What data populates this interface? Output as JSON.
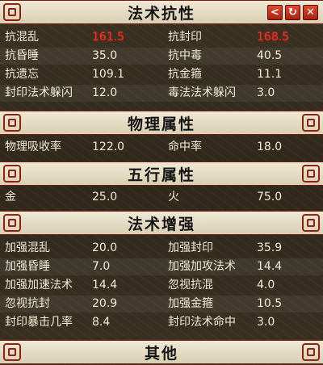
{
  "window": {
    "share_icon": "share-icon",
    "refresh_icon": "refresh-icon",
    "close_icon": "close-icon"
  },
  "sections": [
    {
      "title": "法术抗性",
      "rows": [
        [
          "抗混乱",
          "161.5",
          "抗封印",
          "168.5"
        ],
        [
          "抗昏睡",
          "35.0",
          "抗中毒",
          "40.5"
        ],
        [
          "抗遗忘",
          "109.1",
          "抗金箍",
          "11.1"
        ],
        [
          "封印法术躲闪",
          "12.0",
          "毒法法术躲闪",
          "3.0"
        ]
      ]
    },
    {
      "title": "物理属性",
      "rows": [
        [
          "物理吸收率",
          "122.0",
          "命中率",
          "18.0"
        ]
      ]
    },
    {
      "title": "五行属性",
      "rows": [
        [
          "金",
          "25.0",
          "火",
          "75.0"
        ]
      ]
    },
    {
      "title": "法术增强",
      "rows": [
        [
          "加强混乱",
          "20.0",
          "加强封印",
          "35.9"
        ],
        [
          "加强昏睡",
          "7.0",
          "加强加攻法术",
          "14.4"
        ],
        [
          "加强加速法术",
          "14.4",
          "忽视抗混",
          "4.0"
        ],
        [
          "忽视抗封",
          "20.9",
          "加强金箍",
          "10.5"
        ],
        [
          "封印暴击几率",
          "8.4",
          "封印法术命中",
          "3.0"
        ]
      ]
    },
    {
      "title": "其他",
      "rows": []
    }
  ],
  "highlight_color": "#ff2a1e"
}
